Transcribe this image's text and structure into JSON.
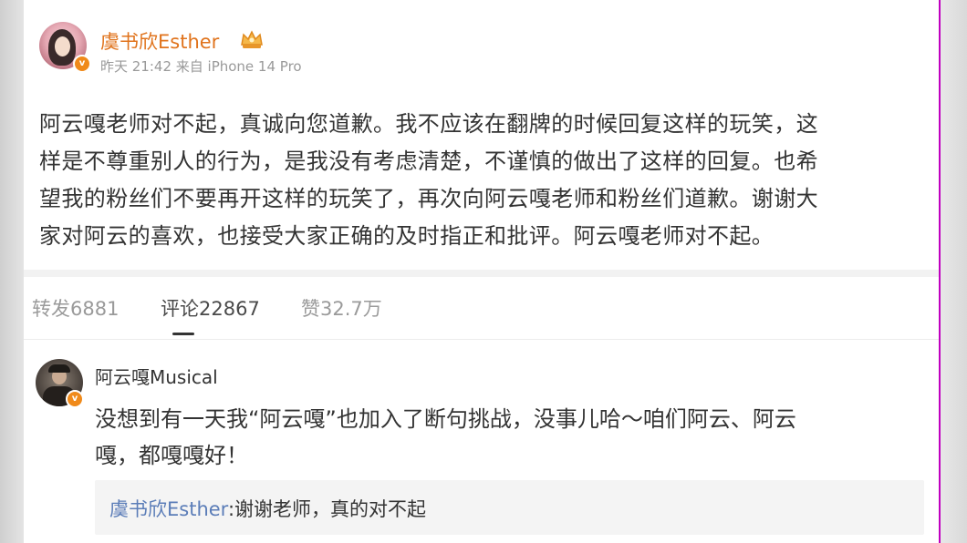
{
  "post": {
    "author": "虞书欣Esther",
    "meta": "昨天 21:42 来自 iPhone 14 Pro",
    "verified_badge": "v",
    "content_lines": [
      "阿云嘎老师对不起，真诚向您道歉。我不应该在翻牌的时候回复这样的玩笑，这",
      "样是不尊重别人的行为，是我没有考虑清楚，不谨慎的做出了这样的回复。也希",
      "望我的粉丝们不要再开这样的玩笑了，再次向阿云嘎老师和粉丝们道歉。谢谢大",
      "家对阿云的喜欢，也接受大家正确的及时指正和批评。阿云嘎老师对不起。"
    ]
  },
  "tabs": {
    "repost": "转发6881",
    "comment": "评论22867",
    "like": "赞32.7万",
    "active": "comment"
  },
  "comment": {
    "author": "阿云嘎Musical",
    "verified_badge": "v",
    "content_lines": [
      "没想到有一天我“阿云嘎”也加入了断句挑战，没事儿哈～咱们阿云、阿云",
      "嘎，都嘎嘎好！"
    ],
    "reply": {
      "author": "虞书欣Esther",
      "separator": ":",
      "text": "谢谢老师，真的对不起"
    }
  },
  "colors": {
    "author_name": "#e0731c",
    "reply_name": "#5b7db8",
    "verified": "#f08a1a"
  }
}
